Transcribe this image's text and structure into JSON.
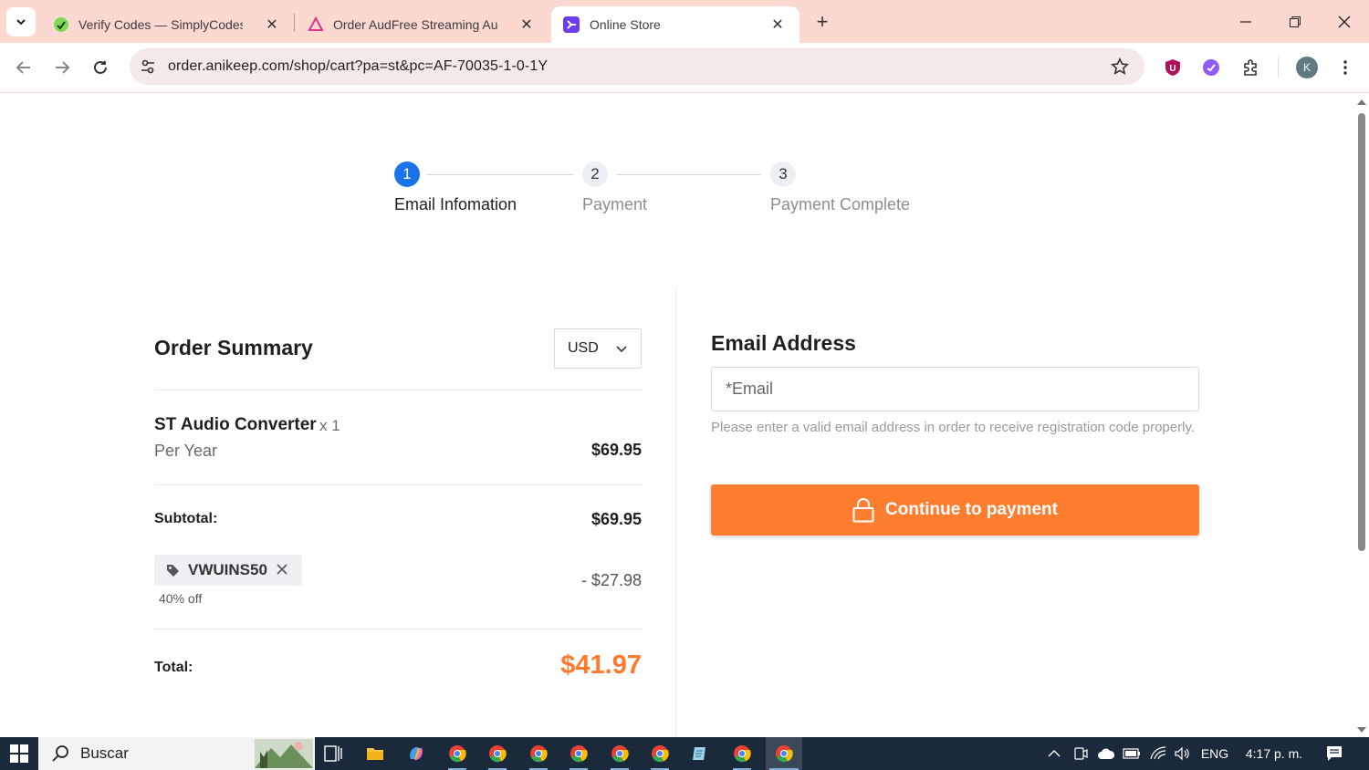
{
  "browser": {
    "tabs": [
      {
        "title": "Verify Codes — SimplyCodes",
        "icon": "simplycodes-icon",
        "active": false
      },
      {
        "title": "Order AudFree Streaming Audio",
        "icon": "audfree-icon",
        "active": false
      },
      {
        "title": "Online Store",
        "icon": "store-icon",
        "active": true
      }
    ],
    "url": "order.anikeep.com/shop/cart?pa=st&pc=AF-70035-1-0-1Y",
    "profile_initial": "K"
  },
  "stepper": {
    "steps": [
      {
        "number": "1",
        "label": "Email Infomation",
        "active": true
      },
      {
        "number": "2",
        "label": "Payment",
        "active": false
      },
      {
        "number": "3",
        "label": "Payment Complete",
        "active": false
      }
    ]
  },
  "summary": {
    "title": "Order Summary",
    "currency": "USD",
    "product_name": "ST Audio Converter",
    "quantity": "x 1",
    "period": "Per Year",
    "price": "$69.95",
    "subtotal_label": "Subtotal:",
    "subtotal_value": "$69.95",
    "coupon_code": "VWUINS50",
    "coupon_percent": "40% off",
    "discount": "- $27.98",
    "total_label": "Total:",
    "total_value": "$41.97"
  },
  "email": {
    "title": "Email Address",
    "placeholder": "*Email",
    "hint": "Please enter a valid email address in order to receive registration code properly.",
    "button_label": "Continue to payment"
  },
  "taskbar": {
    "search_label": "Buscar",
    "language": "ENG",
    "time": "4:17 p. m."
  },
  "colors": {
    "accent": "#ff7d2f",
    "step_active": "#1a73e8",
    "tab_bar": "#fbd9d0"
  }
}
